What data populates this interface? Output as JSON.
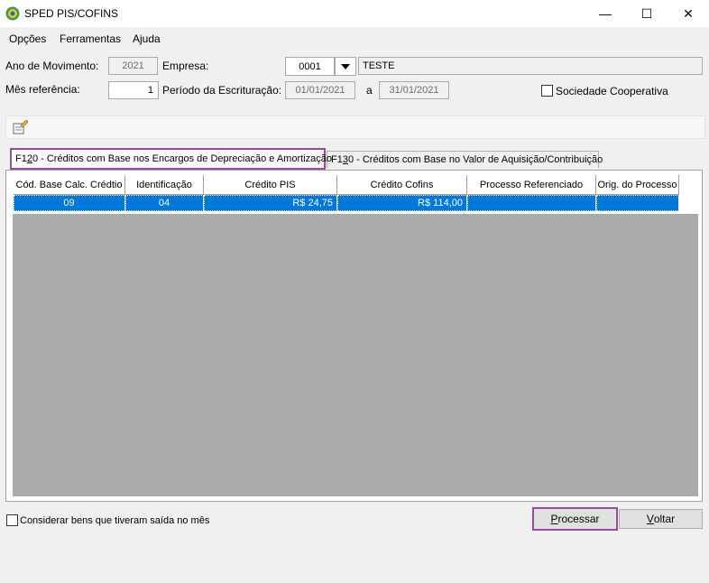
{
  "window": {
    "title": "SPED PIS/COFINS",
    "minimize": "—",
    "maximize": "☐",
    "close": "✕"
  },
  "menu": {
    "items": [
      "Opções",
      "Ferramentas",
      "Ajuda"
    ]
  },
  "form": {
    "ano_label": "Ano de Movimento:",
    "ano_value": "2021",
    "empresa_label": "Empresa:",
    "empresa_code": "0001",
    "empresa_name": "TESTE",
    "mes_label": "Mês referência:",
    "mes_value": "1",
    "periodo_label": "Período da Escrituração:",
    "periodo_start": "01/01/2021",
    "periodo_sep": "a",
    "periodo_end": "31/01/2021",
    "sociedade_label": "Sociedade Cooperativa"
  },
  "toolbar": {
    "icon": "edit-properties-icon"
  },
  "tabs": {
    "active_prefix": "F1",
    "active_underline": "2",
    "active_rest": "0 - Créditos com Base nos Encargos de Depreciação e Amortização",
    "inactive_prefix": "F1",
    "inactive_underline": "3",
    "inactive_rest": "0 - Créditos com Base no Valor de Aquisição/Contribuição"
  },
  "grid": {
    "columns": [
      "Cód. Base Calc. Crédtio",
      "Identificação",
      "Crédito PIS",
      "Crédito Cofins",
      "Processo Referenciado",
      "Orig. do Processo"
    ],
    "rows": [
      {
        "cod": "09",
        "id": "04",
        "pis": "R$ 24,75",
        "cofins": "R$ 114,00",
        "processo": "",
        "orig": ""
      }
    ]
  },
  "footer": {
    "considerar_label": "Considerar bens que tiveram saída no mês",
    "processar_u": "P",
    "processar_rest": "rocessar",
    "voltar_u": "V",
    "voltar_rest": "oltar"
  },
  "colors": {
    "highlight": "#9b4aa3",
    "selection": "#0078d7"
  }
}
